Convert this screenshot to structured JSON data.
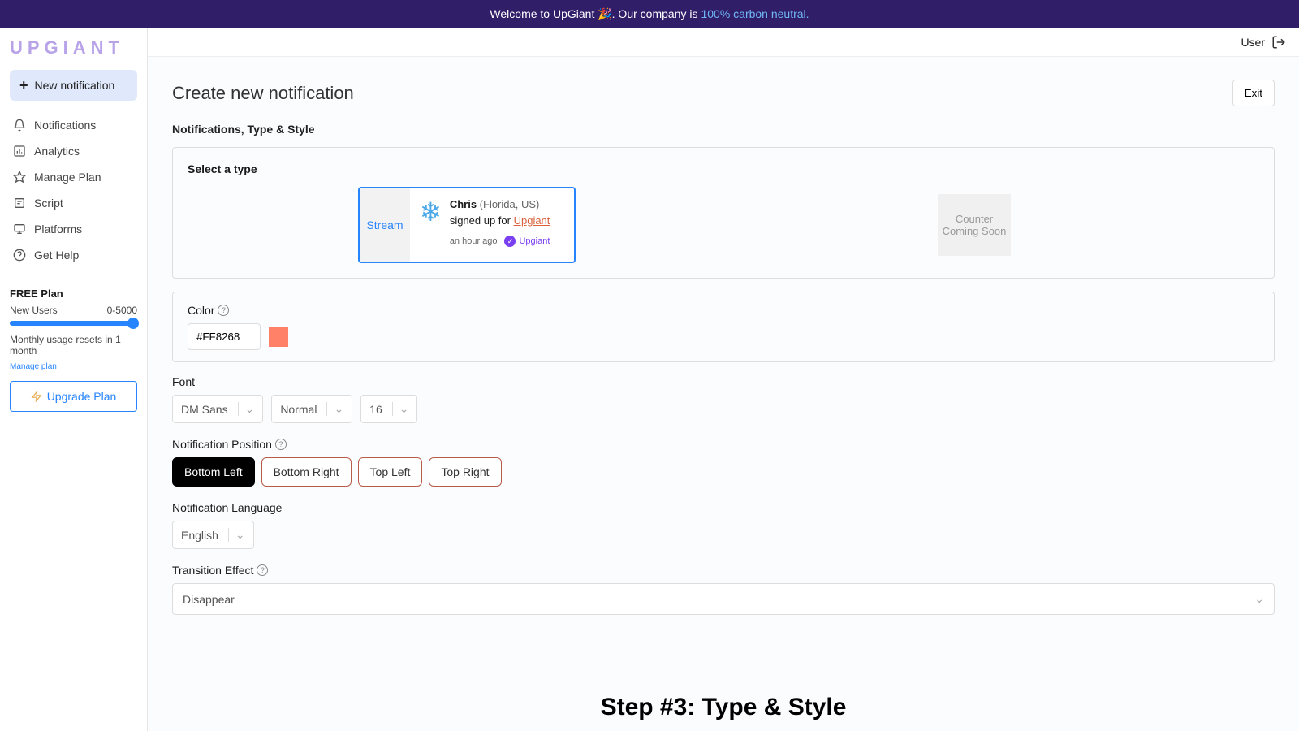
{
  "banner": {
    "welcome": "Welcome to UpGiant 🎉. Our company is",
    "carbon": "100% carbon neutral."
  },
  "logo": "UPGIANT",
  "new_notification": "New notification",
  "nav": {
    "notifications": "Notifications",
    "analytics": "Analytics",
    "manage_plan": "Manage Plan",
    "script": "Script",
    "platforms": "Platforms",
    "get_help": "Get Help"
  },
  "plan": {
    "title": "FREE Plan",
    "metric_label": "New Users",
    "metric_range": "0-5000",
    "reset_text": "Monthly usage resets in 1 month",
    "manage_link": "Manage plan",
    "upgrade": "Upgrade Plan"
  },
  "topbar": {
    "user": "User"
  },
  "page": {
    "title": "Create new notification",
    "exit": "Exit",
    "section": "Notifications, Type & Style",
    "select_type": "Select a type",
    "stream_label": "Stream",
    "preview": {
      "name": "Chris",
      "location": "(Florida,  US)",
      "action": "signed up for ",
      "brand": "Upgiant",
      "time": "an hour ago",
      "verify_brand": "Upgiant"
    },
    "counter": {
      "title": "Counter",
      "sub": "Coming Soon"
    },
    "color": {
      "label": "Color",
      "value": "#FF8268"
    },
    "font": {
      "label": "Font",
      "family": "DM Sans",
      "weight": "Normal",
      "size": "16"
    },
    "position": {
      "label": "Notification Position",
      "options": [
        "Bottom Left",
        "Bottom Right",
        "Top Left",
        "Top Right"
      ],
      "active_index": 0
    },
    "language": {
      "label": "Notification Language",
      "value": "English"
    },
    "transition": {
      "label": "Transition Effect",
      "value": "Disappear"
    },
    "overlay": "Step #3: Type & Style"
  }
}
